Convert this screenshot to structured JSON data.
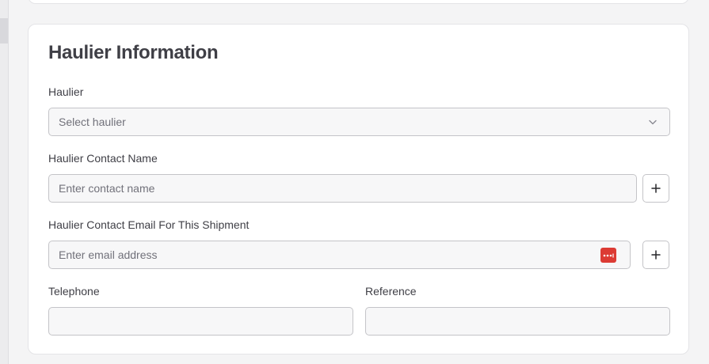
{
  "section": {
    "title": "Haulier Information"
  },
  "fields": {
    "haulier": {
      "label": "Haulier",
      "placeholder": "Select haulier"
    },
    "contact_name": {
      "label": "Haulier Contact Name",
      "placeholder": "Enter contact name"
    },
    "contact_email": {
      "label": "Haulier Contact Email For This Shipment",
      "placeholder": "Enter email address"
    },
    "telephone": {
      "label": "Telephone",
      "value": ""
    },
    "reference": {
      "label": "Reference",
      "value": ""
    }
  },
  "icons": {
    "chevron": "chevron-down-icon",
    "add": "plus-icon",
    "password_manager": "password-manager-icon"
  },
  "colors": {
    "password_manager_badge": "#dc3b34",
    "field_border": "#c4c4c8",
    "field_background": "#f7f7f8"
  }
}
